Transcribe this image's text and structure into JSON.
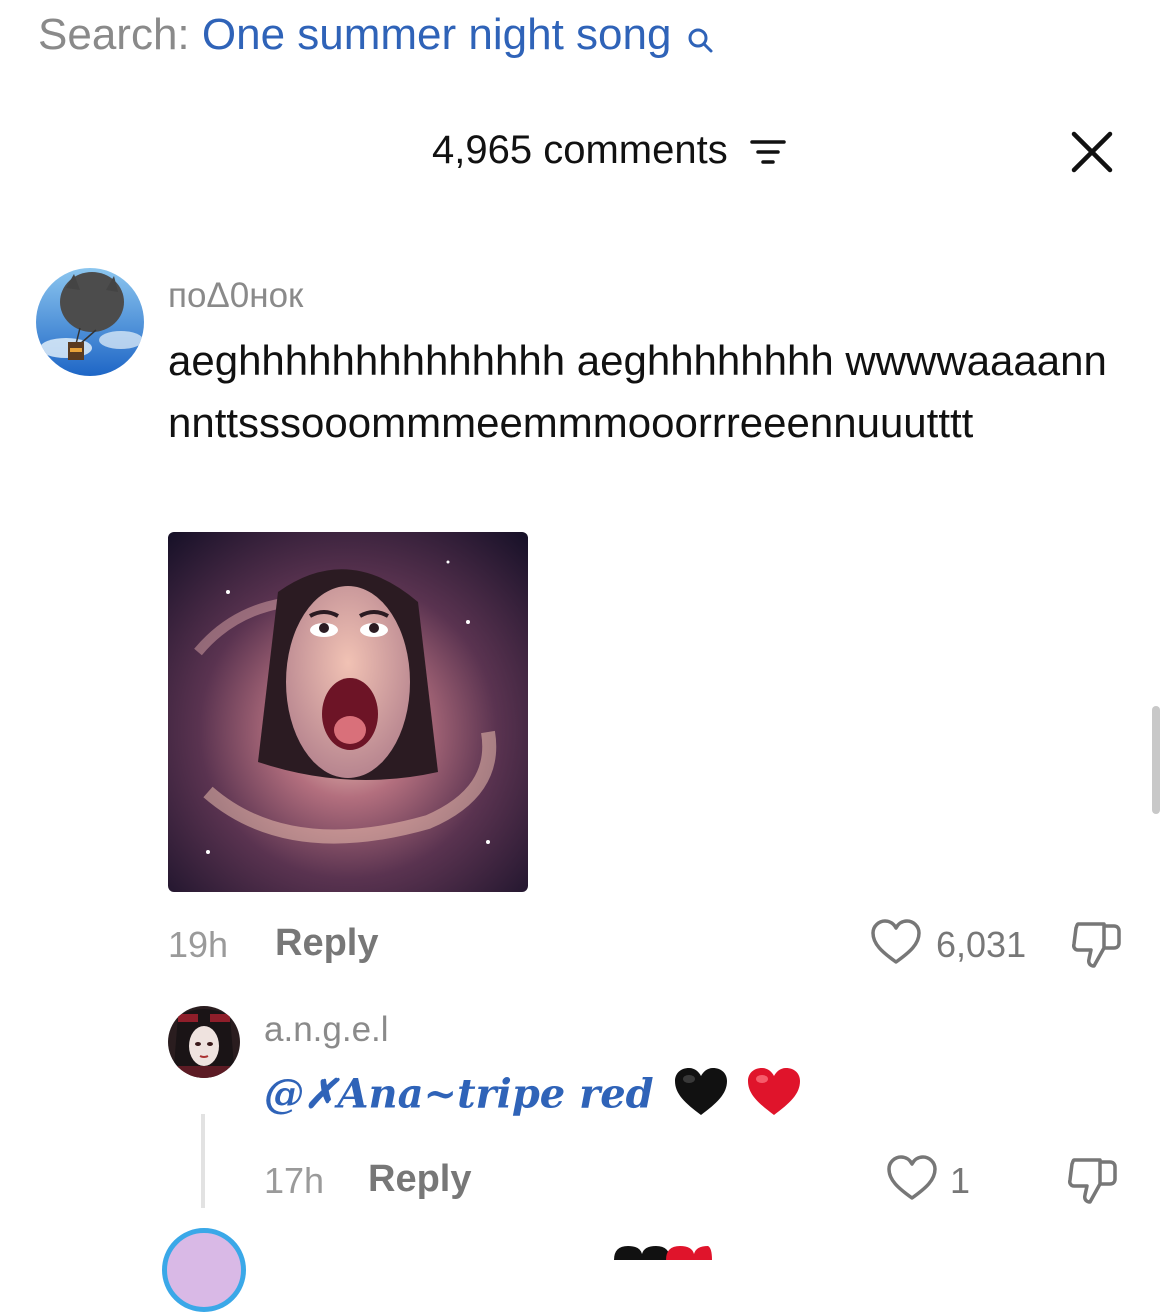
{
  "search": {
    "label": "Search:",
    "query": "One summer night song"
  },
  "header": {
    "comments_count": "4,965 comments"
  },
  "comments": [
    {
      "username": "поΔ0нок",
      "text": "aeghhhhhhhhhhhhhh aeghhhhhhhh wwwwaaaannnnttsssooommmeemmmooorrreeennuuutttt",
      "time": "19h",
      "reply_label": "Reply",
      "likes": "6,031"
    }
  ],
  "replies": [
    {
      "username": "a.n.g.e.l",
      "mention": "@✗Ana~tripe red",
      "emojis": [
        "black-heart",
        "red-heart"
      ],
      "time": "17h",
      "reply_label": "Reply",
      "likes": "1"
    }
  ],
  "colors": {
    "link_blue": "#2f63b8",
    "muted_gray": "#8a8a8a",
    "heart_red": "#e0142b"
  }
}
